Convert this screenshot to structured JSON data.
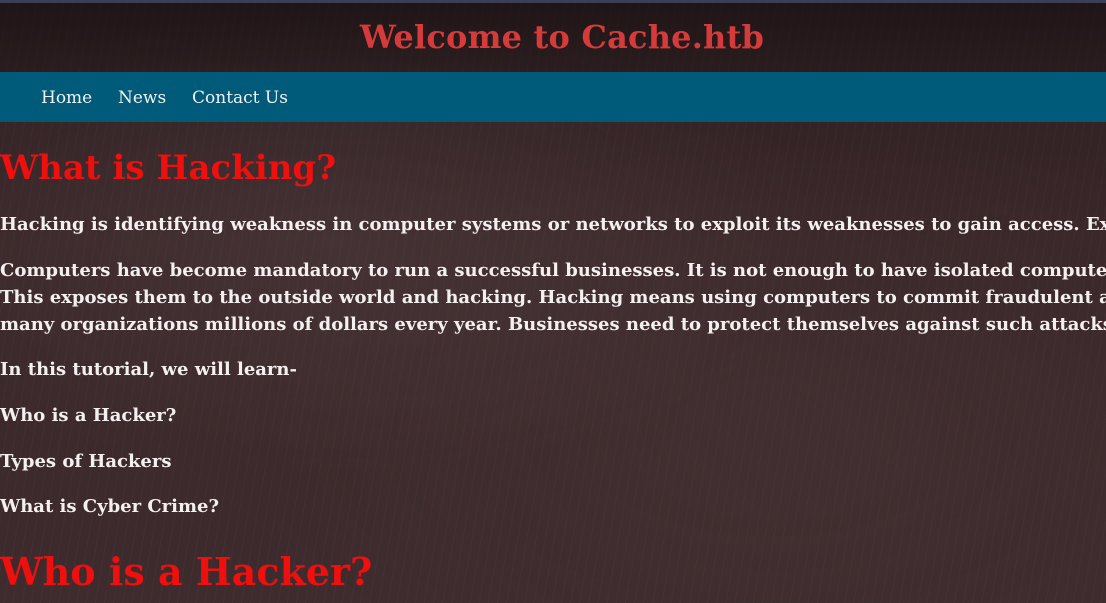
{
  "header": {
    "title": "Welcome to Cache.htb"
  },
  "nav": {
    "home": "Home",
    "news": "News",
    "contact": "Contact Us"
  },
  "main": {
    "heading_1": "What is Hacking?",
    "para_1": "Hacking is identifying weakness in computer systems or networks to exploit its weaknesses to gain access. Example o",
    "para_2_line_1": "Computers have become mandatory to run a successful businesses. It is not enough to have isolated computers syster",
    "para_2_line_2": "This exposes them to the outside world and hacking. Hacking means using computers to commit fraudulent acts such",
    "para_2_line_3": "many organizations millions of dollars every year. Businesses need to protect themselves against such attacks.",
    "para_3": "In this tutorial, we will learn-",
    "list_item_1": "Who is a Hacker?",
    "list_item_2": "Types of Hackers",
    "list_item_3": "What is Cyber Crime?",
    "heading_2": "Who is a Hacker?"
  },
  "colors": {
    "title": "#d63b3b",
    "navbar": "#005a79",
    "heading": "#ee0f0f",
    "text": "#f4f0f0",
    "background": "#382628"
  }
}
